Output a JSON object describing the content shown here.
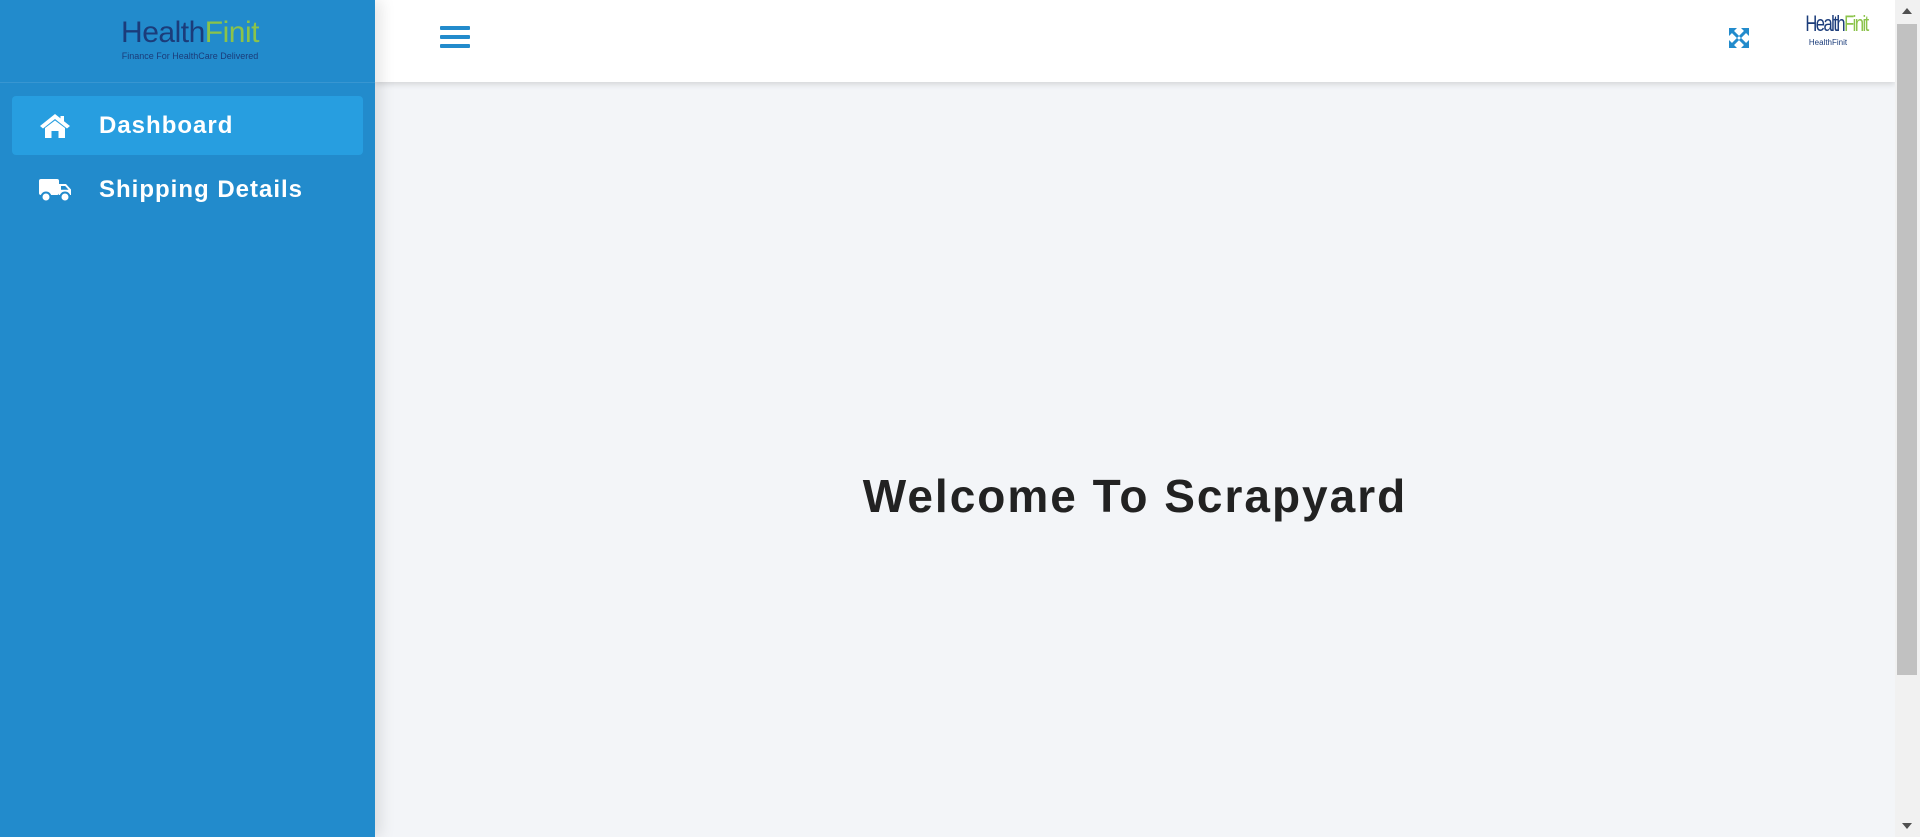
{
  "sidebar": {
    "brand": {
      "name_part1": "Health",
      "name_part2": "Finit",
      "tagline": "Finance For HealthCare Delivered"
    },
    "items": [
      {
        "label": "Dashboard",
        "icon": "home-icon",
        "active": true
      },
      {
        "label": "Shipping Details",
        "icon": "truck-icon",
        "active": false
      }
    ]
  },
  "topbar": {
    "menu_icon": "hamburger-menu-icon",
    "fullscreen_icon": "expand-icon",
    "profile_logo": {
      "name_part1": "Health",
      "name_part2": "Finit",
      "sub": "HealthFinit"
    }
  },
  "main": {
    "welcome": "Welcome To Scrapyard"
  },
  "colors": {
    "sidebar_bg": "#228bcc",
    "sidebar_active": "#279ee0",
    "brand_dark": "#1b3c7a",
    "brand_green": "#8bc34a",
    "content_bg": "#f3f5f8"
  }
}
